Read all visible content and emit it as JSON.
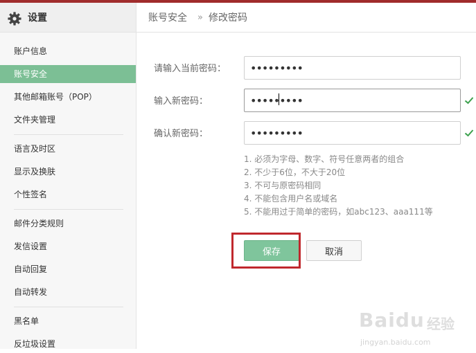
{
  "colors": {
    "accent": "#7cbf95",
    "highlight": "#c0282d",
    "check": "#3aa04c",
    "topbar": "#a02c2c"
  },
  "sidebar": {
    "title": "设置",
    "icon": "gear-icon",
    "items": [
      {
        "label": "账户信息"
      },
      {
        "label": "账号安全",
        "active": true
      },
      {
        "label": "其他邮箱账号（POP）"
      },
      {
        "label": "文件夹管理"
      },
      {
        "label": "语言及时区"
      },
      {
        "label": "显示及换肤"
      },
      {
        "label": "个性签名"
      },
      {
        "label": "邮件分类规则"
      },
      {
        "label": "发信设置"
      },
      {
        "label": "自动回复"
      },
      {
        "label": "自动转发"
      },
      {
        "label": "黑名单"
      },
      {
        "label": "反垃圾设置"
      }
    ]
  },
  "header": {
    "breadcrumb": [
      "账号安全",
      "修改密码"
    ],
    "separator": "»"
  },
  "form": {
    "current_password": {
      "label": "请输入当前密码：",
      "value": "•••••••••"
    },
    "new_password": {
      "label": "输入新密码：",
      "value": "•••••••••",
      "valid": true
    },
    "confirm_password": {
      "label": "确认新密码：",
      "value": "•••••••••",
      "valid": true
    },
    "rules": [
      "1. 必须为字母、数字、符号任意两者的组合",
      "2. 不少于6位，不大于20位",
      "3. 不可与原密码相同",
      "4. 不能包含用户名或域名",
      "5. 不能用过于简单的密码，如abc123、aaa111等"
    ],
    "save_label": "保存",
    "cancel_label": "取消"
  },
  "watermark": {
    "logo": "Baidu",
    "name": "经验",
    "url": "jingyan.baidu.com"
  }
}
